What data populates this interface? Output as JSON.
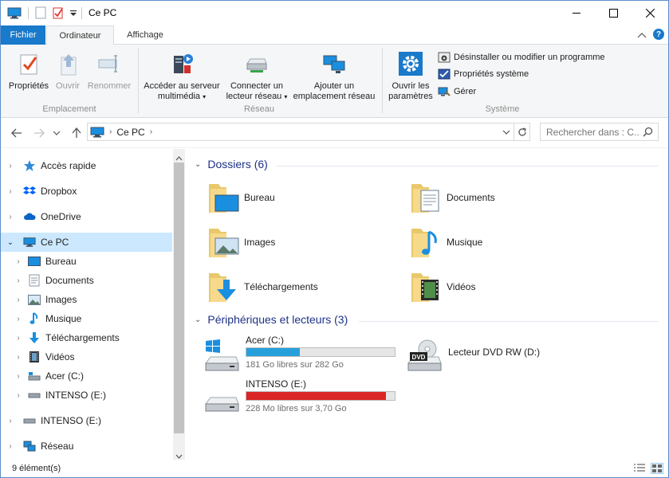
{
  "window": {
    "title": "Ce PC",
    "accent_color": "#1979ca"
  },
  "ribbon_tabs": {
    "file": "Fichier",
    "computer": "Ordinateur",
    "view": "Affichage"
  },
  "ribbon": {
    "location": {
      "label": "Emplacement",
      "properties": "Propriétés",
      "open": "Ouvrir",
      "rename": "Renommer"
    },
    "network": {
      "label": "Réseau",
      "media_line1": "Accéder au serveur",
      "media_line2": "multimédia",
      "map_line1": "Connecter un",
      "map_line2": "lecteur réseau",
      "add_line1": "Ajouter un",
      "add_line2": "emplacement réseau"
    },
    "system": {
      "label": "Système",
      "settings_line1": "Ouvrir les",
      "settings_line2": "paramètres",
      "uninstall": "Désinstaller ou modifier un programme",
      "sys_props": "Propriétés système",
      "manage": "Gérer"
    }
  },
  "address": {
    "crumb": "Ce PC",
    "search_placeholder": "Rechercher dans : C..."
  },
  "sidebar": {
    "quick_access": "Accès rapide",
    "dropbox": "Dropbox",
    "onedrive": "OneDrive",
    "this_pc": "Ce PC",
    "desktop": "Bureau",
    "documents": "Documents",
    "images": "Images",
    "music": "Musique",
    "downloads": "Téléchargements",
    "videos": "Vidéos",
    "drive_c": "Acer (C:)",
    "drive_e": "INTENSO (E:)",
    "drive_e_root": "INTENSO (E:)",
    "network": "Réseau"
  },
  "content": {
    "folders_header": "Dossiers (6)",
    "folders": {
      "desktop": "Bureau",
      "documents": "Documents",
      "images": "Images",
      "music": "Musique",
      "downloads": "Téléchargements",
      "videos": "Vidéos"
    },
    "devices_header": "Périphériques et lecteurs (3)",
    "drives": {
      "c_name": "Acer (C:)",
      "c_free": "181 Go libres sur 282 Go",
      "c_used_fraction": 0.36,
      "c_bar_color": "#26a0da",
      "dvd_name": "Lecteur DVD RW (D:)",
      "e_name": "INTENSO (E:)",
      "e_free": "228 Mo libres sur 3,70 Go",
      "e_used_fraction": 0.94,
      "e_bar_color": "#da2626"
    }
  },
  "status": {
    "item_count": "9 élément(s)"
  }
}
